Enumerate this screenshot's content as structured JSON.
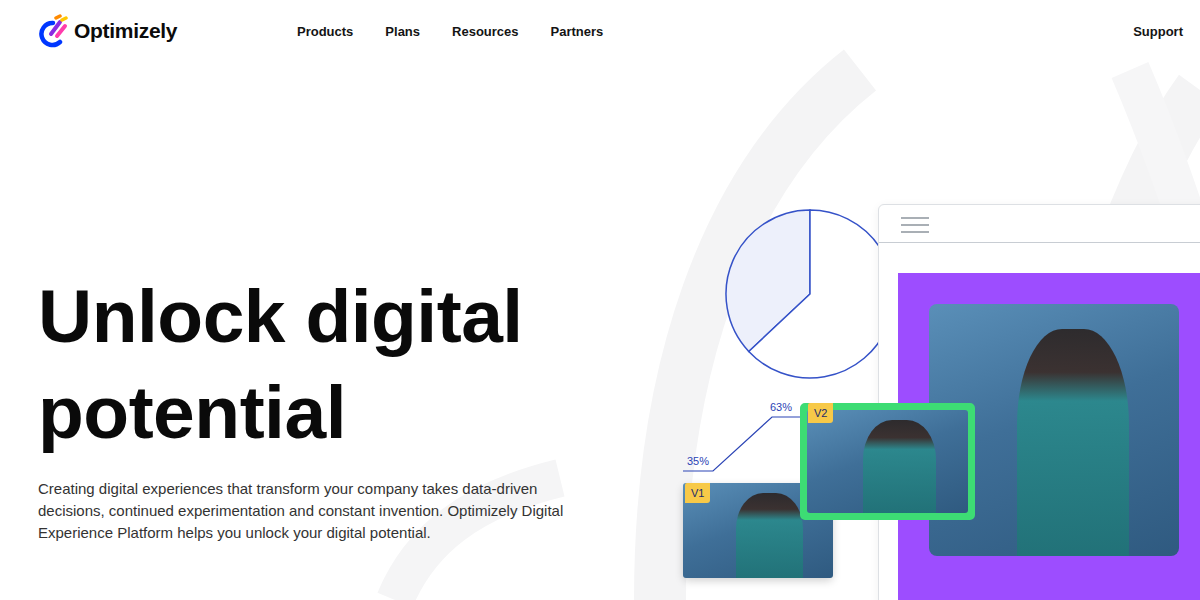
{
  "nav": {
    "logo": "Optimizely",
    "items": [
      {
        "label": "Products"
      },
      {
        "label": "Plans"
      },
      {
        "label": "Resources"
      },
      {
        "label": "Partners"
      }
    ],
    "support": "Support"
  },
  "hero": {
    "title": [
      "Unlock digital",
      "potential"
    ],
    "description": "Creating digital experiences that transform your company takes data-driven decisions, continued experimentation and constant invention. Optimizely Digital Experience Platform helps you unlock your digital potential."
  },
  "illustration": {
    "pie": {
      "values": [
        37,
        63
      ]
    },
    "variants": [
      {
        "label": "V1",
        "reading": "35%",
        "selected": false
      },
      {
        "label": "V2",
        "reading": "63%",
        "selected": true
      }
    ]
  }
}
